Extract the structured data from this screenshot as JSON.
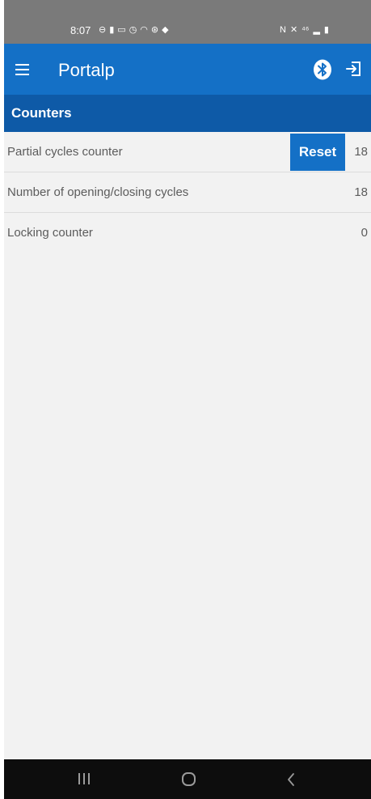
{
  "status_bar": {
    "time": "8:07",
    "left_icons": [
      "⊖",
      "▮",
      "▭",
      "◷",
      "◠",
      "⊛",
      "◆"
    ],
    "right_icons": [
      "N",
      "✕",
      "⁴⁶",
      "▂",
      "▮"
    ]
  },
  "app_bar": {
    "title": "Portalp",
    "icons": [
      "menu-icon",
      "bluetooth-icon",
      "logout-icon"
    ]
  },
  "section": {
    "title": "Counters"
  },
  "counters": [
    {
      "label": "Partial cycles counter",
      "value": "18",
      "button": "Reset"
    },
    {
      "label": "Number of opening/closing cycles",
      "value": "18"
    },
    {
      "label": "Locking counter",
      "value": "0"
    }
  ],
  "colors": {
    "app_bar": "#1470c6",
    "section_header": "#0e5aa7",
    "background": "#f2f2f2",
    "nav_bar": "#0d0d0d"
  }
}
